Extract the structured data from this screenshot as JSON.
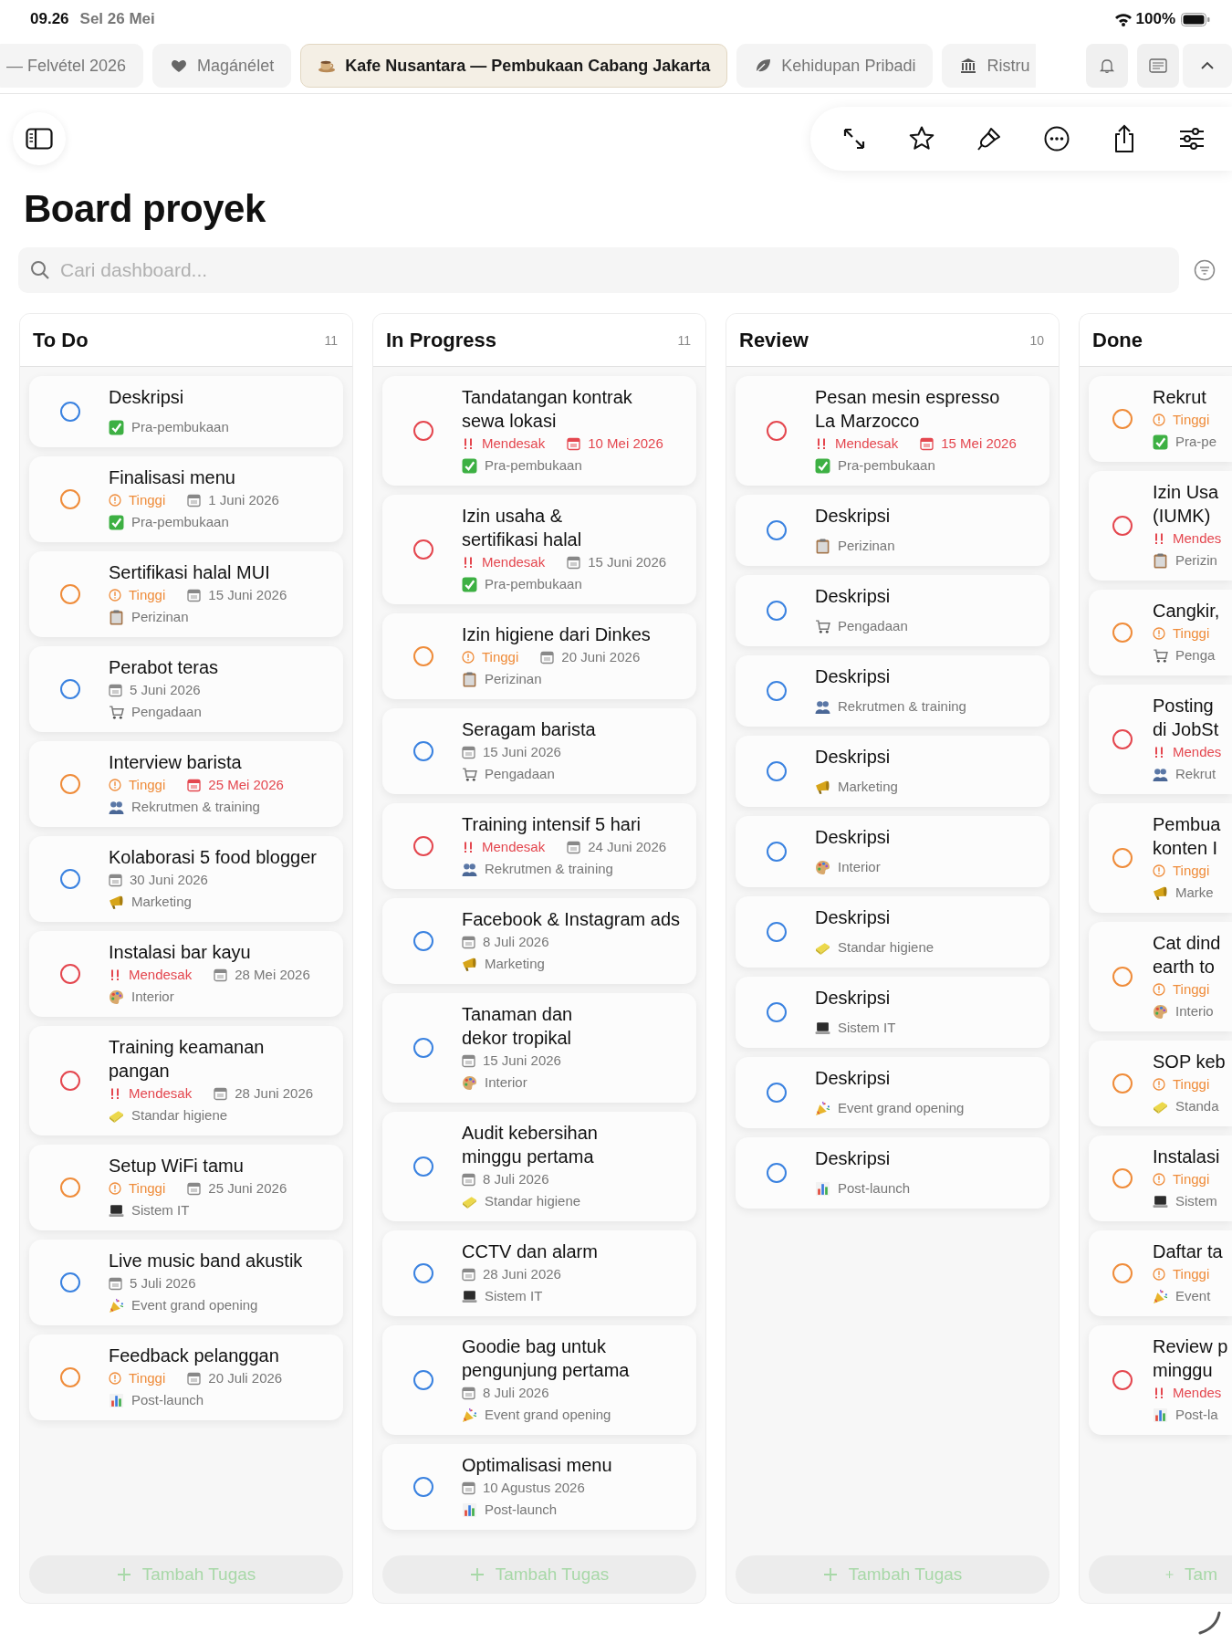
{
  "status_bar": {
    "time": "09.26",
    "date": "Sel 26 Mei",
    "battery": "100%"
  },
  "tabs": [
    {
      "label": "— Felvétel 2026",
      "kind": "plain",
      "selected": false
    },
    {
      "label": "Magánélet",
      "kind": "heart",
      "selected": false
    },
    {
      "label": "Kafe Nusantara — Pembukaan Cabang Jakarta",
      "kind": "cup",
      "selected": true
    },
    {
      "label": "Kehidupan Pribadi",
      "kind": "leaf",
      "selected": false
    },
    {
      "label": "Ristru",
      "kind": "building",
      "selected": false
    }
  ],
  "page": {
    "title": "Board proyek"
  },
  "search": {
    "placeholder": "Cari dashboard..."
  },
  "columns": [
    {
      "title": "To Do",
      "count": "11",
      "add_label": "Tambah Tugas",
      "cards": [
        {
          "title": "Deskripsi",
          "kind": "none",
          "category": {
            "kind": "check",
            "label": "Pra-pembukaan"
          }
        },
        {
          "title": "Finalisasi menu",
          "kind": "high",
          "priority_label": "Tinggi",
          "due": "1 Juni 2026",
          "overdue": false,
          "category": {
            "kind": "check",
            "label": "Pra-pembukaan"
          }
        },
        {
          "title": "Sertifikasi halal MUI",
          "kind": "high",
          "priority_label": "Tinggi",
          "due": "15 Juni 2026",
          "overdue": false,
          "category": {
            "kind": "clipboard",
            "label": "Perizinan"
          }
        },
        {
          "title": "Perabot teras",
          "kind": "none",
          "due": "5 Juni 2026",
          "overdue": false,
          "category": {
            "kind": "cart",
            "label": "Pengadaan"
          }
        },
        {
          "title": "Interview barista",
          "kind": "high",
          "priority_label": "Tinggi",
          "due": "25 Mei 2026",
          "overdue": true,
          "category": {
            "kind": "people",
            "label": "Rekrutmen & training"
          }
        },
        {
          "title": "Kolaborasi 5 food blogger",
          "kind": "none",
          "due": "30 Juni 2026",
          "overdue": false,
          "category": {
            "kind": "megaphone",
            "label": "Marketing"
          }
        },
        {
          "title": "Instalasi bar kayu",
          "kind": "urgent",
          "priority_label": "Mendesak",
          "due": "28 Mei 2026",
          "overdue": false,
          "category": {
            "kind": "palette",
            "label": "Interior"
          }
        },
        {
          "title": "Training keamanan\npangan",
          "kind": "urgent",
          "priority_label": "Mendesak",
          "due": "28 Juni 2026",
          "overdue": false,
          "category": {
            "kind": "sponge",
            "label": "Standar higiene"
          }
        },
        {
          "title": "Setup WiFi tamu",
          "kind": "high",
          "priority_label": "Tinggi",
          "due": "25 Juni 2026",
          "overdue": false,
          "category": {
            "kind": "laptop",
            "label": "Sistem IT"
          }
        },
        {
          "title": "Live music band akustik",
          "kind": "none",
          "due": "5 Juli 2026",
          "overdue": false,
          "category": {
            "kind": "party",
            "label": "Event grand opening"
          }
        },
        {
          "title": "Feedback pelanggan",
          "kind": "high",
          "priority_label": "Tinggi",
          "due": "20 Juli 2026",
          "overdue": false,
          "category": {
            "kind": "chart",
            "label": "Post-launch"
          }
        }
      ]
    },
    {
      "title": "In Progress",
      "count": "11",
      "add_label": "Tambah Tugas",
      "cards": [
        {
          "title": "Tandatangan kontrak\nsewa lokasi",
          "kind": "urgent",
          "priority_label": "Mendesak",
          "due": "10 Mei 2026",
          "overdue": true,
          "category": {
            "kind": "check",
            "label": "Pra-pembukaan"
          }
        },
        {
          "title": "Izin usaha &\nsertifikasi halal",
          "kind": "urgent",
          "priority_label": "Mendesak",
          "due": "15 Juni 2026",
          "overdue": false,
          "category": {
            "kind": "check",
            "label": "Pra-pembukaan"
          }
        },
        {
          "title": "Izin higiene dari Dinkes",
          "kind": "high",
          "priority_label": "Tinggi",
          "due": "20 Juni 2026",
          "overdue": false,
          "category": {
            "kind": "clipboard",
            "label": "Perizinan"
          }
        },
        {
          "title": "Seragam barista",
          "kind": "none",
          "due": "15 Juni 2026",
          "overdue": false,
          "category": {
            "kind": "cart",
            "label": "Pengadaan"
          }
        },
        {
          "title": "Training intensif 5 hari",
          "kind": "urgent",
          "priority_label": "Mendesak",
          "due": "24 Juni 2026",
          "overdue": false,
          "category": {
            "kind": "people",
            "label": "Rekrutmen & training"
          }
        },
        {
          "title": "Facebook & Instagram ads",
          "kind": "none",
          "due": "8 Juli 2026",
          "overdue": false,
          "category": {
            "kind": "megaphone",
            "label": "Marketing"
          }
        },
        {
          "title": "Tanaman dan\ndekor tropikal",
          "kind": "none",
          "due": "15 Juni 2026",
          "overdue": false,
          "category": {
            "kind": "palette",
            "label": "Interior"
          }
        },
        {
          "title": "Audit kebersihan\nminggu pertama",
          "kind": "none",
          "due": "8 Juli 2026",
          "overdue": false,
          "category": {
            "kind": "sponge",
            "label": "Standar higiene"
          }
        },
        {
          "title": "CCTV dan alarm",
          "kind": "none",
          "due": "28 Juni 2026",
          "overdue": false,
          "category": {
            "kind": "laptop",
            "label": "Sistem IT"
          }
        },
        {
          "title": "Goodie bag untuk\npengunjung pertama",
          "kind": "none",
          "due": "8 Juli 2026",
          "overdue": false,
          "category": {
            "kind": "party",
            "label": "Event grand opening"
          }
        },
        {
          "title": "Optimalisasi menu",
          "kind": "none",
          "due": "10 Agustus 2026",
          "overdue": false,
          "category": {
            "kind": "chart",
            "label": "Post-launch"
          }
        }
      ]
    },
    {
      "title": "Review",
      "count": "10",
      "add_label": "Tambah Tugas",
      "cards": [
        {
          "title": "Pesan mesin espresso\nLa Marzocco",
          "kind": "urgent",
          "priority_label": "Mendesak",
          "due": "15 Mei 2026",
          "overdue": true,
          "category": {
            "kind": "check",
            "label": "Pra-pembukaan"
          }
        },
        {
          "title": "Deskripsi",
          "kind": "none",
          "category": {
            "kind": "clipboard",
            "label": "Perizinan"
          }
        },
        {
          "title": "Deskripsi",
          "kind": "none",
          "category": {
            "kind": "cart",
            "label": "Pengadaan"
          }
        },
        {
          "title": "Deskripsi",
          "kind": "none",
          "category": {
            "kind": "people",
            "label": "Rekrutmen & training"
          }
        },
        {
          "title": "Deskripsi",
          "kind": "none",
          "category": {
            "kind": "megaphone",
            "label": "Marketing"
          }
        },
        {
          "title": "Deskripsi",
          "kind": "none",
          "category": {
            "kind": "palette",
            "label": "Interior"
          }
        },
        {
          "title": "Deskripsi",
          "kind": "none",
          "category": {
            "kind": "sponge",
            "label": "Standar higiene"
          }
        },
        {
          "title": "Deskripsi",
          "kind": "none",
          "category": {
            "kind": "laptop",
            "label": "Sistem IT"
          }
        },
        {
          "title": "Deskripsi",
          "kind": "none",
          "category": {
            "kind": "party",
            "label": "Event grand opening"
          }
        },
        {
          "title": "Deskripsi",
          "kind": "none",
          "category": {
            "kind": "chart",
            "label": "Post-launch"
          }
        }
      ]
    },
    {
      "title": "Done",
      "add_label": "Tam",
      "cards": [
        {
          "title": "Rekrut",
          "kind": "high",
          "priority_label": "Tinggi",
          "category": {
            "kind": "check",
            "label": "Pra-pe"
          }
        },
        {
          "title": "Izin Usa\n(IUMK)",
          "kind": "urgent",
          "priority_label": "Mendes",
          "category": {
            "kind": "clipboard",
            "label": "Perizin"
          }
        },
        {
          "title": "Cangkir,",
          "kind": "high",
          "priority_label": "Tinggi",
          "category": {
            "kind": "cart",
            "label": "Penga"
          }
        },
        {
          "title": "Posting\ndi JobSt",
          "kind": "urgent",
          "priority_label": "Mendes",
          "category": {
            "kind": "people",
            "label": "Rekrut"
          }
        },
        {
          "title": "Pembua\nkonten I",
          "kind": "high",
          "priority_label": "Tinggi",
          "category": {
            "kind": "megaphone",
            "label": "Marke"
          }
        },
        {
          "title": "Cat dind\nearth to",
          "kind": "high",
          "priority_label": "Tinggi",
          "category": {
            "kind": "palette",
            "label": "Interio"
          }
        },
        {
          "title": "SOP keb",
          "kind": "high",
          "priority_label": "Tinggi",
          "category": {
            "kind": "sponge",
            "label": "Standa"
          }
        },
        {
          "title": "Instalasi",
          "kind": "high",
          "priority_label": "Tinggi",
          "category": {
            "kind": "laptop",
            "label": "Sistem"
          }
        },
        {
          "title": "Daftar ta",
          "kind": "high",
          "priority_label": "Tinggi",
          "category": {
            "kind": "party",
            "label": "Event"
          }
        },
        {
          "title": "Review p\nminggu",
          "kind": "urgent",
          "priority_label": "Mendes",
          "category": {
            "kind": "chart",
            "label": "Post-la"
          }
        }
      ]
    }
  ]
}
